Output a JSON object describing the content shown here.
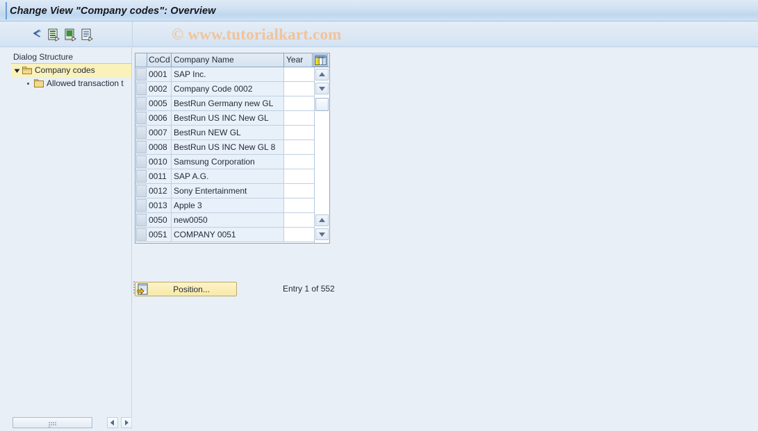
{
  "window": {
    "title": "Change View \"Company codes\": Overview"
  },
  "watermark": {
    "text": "© www.tutorialkart.com",
    "color": "#f0c49a"
  },
  "toolbar": {
    "buttons": [
      {
        "name": "back-arrow-icon",
        "tooltip": "Back"
      },
      {
        "name": "new-entries-icon",
        "tooltip": "New Entries"
      },
      {
        "name": "copy-as-icon",
        "tooltip": "Copy As..."
      },
      {
        "name": "details-icon",
        "tooltip": "Details"
      }
    ]
  },
  "sidebar": {
    "header": "Dialog Structure",
    "tree": [
      {
        "label": "Company codes",
        "level": 1,
        "selected": true,
        "expanded": true
      },
      {
        "label": "Allowed transaction t",
        "level": 2,
        "selected": false,
        "expanded": false
      }
    ],
    "splitter": "sidebar-splitter"
  },
  "table": {
    "columns": [
      {
        "key": "sel",
        "label": ""
      },
      {
        "key": "cocd",
        "label": "CoCd"
      },
      {
        "key": "cname",
        "label": "Company Name"
      },
      {
        "key": "year",
        "label": "Year"
      }
    ],
    "config_icon": "table-settings-icon",
    "rows": [
      {
        "cocd": "0001",
        "cname": "SAP Inc.",
        "year": ""
      },
      {
        "cocd": "0002",
        "cname": "Company Code 0002",
        "year": ""
      },
      {
        "cocd": "0005",
        "cname": "BestRun Germany new GL",
        "year": ""
      },
      {
        "cocd": "0006",
        "cname": "BestRun US INC New GL",
        "year": ""
      },
      {
        "cocd": "0007",
        "cname": "BestRun NEW GL",
        "year": ""
      },
      {
        "cocd": "0008",
        "cname": "BestRun US INC New GL 8",
        "year": ""
      },
      {
        "cocd": "0010",
        "cname": "Samsung Corporation",
        "year": ""
      },
      {
        "cocd": "0011",
        "cname": "SAP A.G.",
        "year": ""
      },
      {
        "cocd": "0012",
        "cname": "Sony Entertainment",
        "year": ""
      },
      {
        "cocd": "0013",
        "cname": "Apple 3",
        "year": ""
      },
      {
        "cocd": "0050",
        "cname": "new0050",
        "year": ""
      },
      {
        "cocd": "0051",
        "cname": "COMPANY 0051",
        "year": ""
      }
    ],
    "scrollbar": {
      "top_up": "scroll-up-icon",
      "top_down": "scroll-down-icon",
      "bottom_up": "scroll-up-icon",
      "bottom_down": "scroll-down-icon"
    }
  },
  "footer": {
    "position_button": "Position...",
    "position_icon": "position-icon",
    "entry_status": "Entry 1 of 552"
  },
  "bottom_scroll": {
    "left_arrow": "arrow-left-icon",
    "right_arrow": "arrow-right-icon"
  },
  "colors": {
    "background": "#e9eff7",
    "title_bar": "#cfe0f2",
    "selected_tree": "#faf2bb",
    "table_row": "#e8f0f9",
    "button_yellow": "#f7e9a8",
    "border": "#8ba6c2"
  }
}
